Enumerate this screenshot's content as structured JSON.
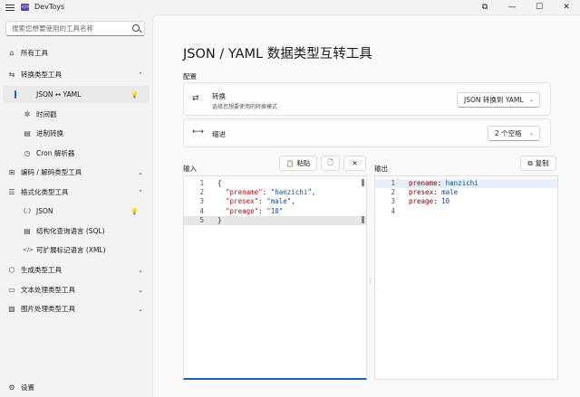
{
  "app": {
    "title": "DevToys",
    "logo_text": "</>"
  },
  "window_controls": {
    "snap": "⧉",
    "minimize": "—",
    "maximize": "☐",
    "close": "✕"
  },
  "sidebar": {
    "search_placeholder": "搜索您想要使用的工具名称",
    "items": [
      {
        "label": "所有工具",
        "icon": "⌂"
      },
      {
        "label": "转换类型工具",
        "icon": "⇆",
        "chevron": "⌃"
      },
      {
        "label": "JSON ↔ YAML",
        "icon": "",
        "selected": true,
        "bulb": "💡"
      },
      {
        "label": "时间戳",
        "icon": "✲"
      },
      {
        "label": "进制转换",
        "icon": "▤"
      },
      {
        "label": "Cron 解析器",
        "icon": "◷"
      },
      {
        "label": "编码 / 解码类型工具",
        "icon": "⊞",
        "chevron": "⌄"
      },
      {
        "label": "格式化类型工具",
        "icon": "☰",
        "chevron": "⌃"
      },
      {
        "label": "JSON",
        "icon": "{;}",
        "bulb": "💡"
      },
      {
        "label": "结构化查询语言 (SQL)",
        "icon": "▤"
      },
      {
        "label": "可扩展标记语言 (XML)",
        "icon": "</>"
      },
      {
        "label": "生成类型工具",
        "icon": "⬡",
        "chevron": "⌄"
      },
      {
        "label": "文本处理类型工具",
        "icon": "▭",
        "chevron": "⌄"
      },
      {
        "label": "图片处理类型工具",
        "icon": "▨",
        "chevron": "⌄"
      }
    ],
    "settings_label": "设置",
    "settings_icon": "⚙"
  },
  "main": {
    "title": "JSON / YAML 数据类型互转工具",
    "config_label": "配置",
    "conversion": {
      "icon": "⇄",
      "title": "转换",
      "subtitle": "选择您想要使用的转换模式",
      "value": "JSON 转换到 YAML",
      "chevron": "⌄"
    },
    "indent": {
      "icon": "⟷",
      "title": "缩进",
      "value": "2 个空格",
      "chevron": "⌄"
    },
    "input": {
      "label": "输入",
      "paste_label": "粘贴",
      "paste_icon": "📋",
      "open_icon": "🗋",
      "clear_icon": "✕",
      "lines": [
        {
          "n": "1",
          "parts": [
            {
              "t": "{",
              "c": "brace"
            }
          ]
        },
        {
          "n": "2",
          "parts": [
            {
              "t": "  ",
              "c": ""
            },
            {
              "t": "\"prename\"",
              "c": "key"
            },
            {
              "t": ": ",
              "c": ""
            },
            {
              "t": "\"hanzichi\"",
              "c": "str"
            },
            {
              "t": ",",
              "c": ""
            }
          ]
        },
        {
          "n": "3",
          "parts": [
            {
              "t": "  ",
              "c": ""
            },
            {
              "t": "\"presex\"",
              "c": "key"
            },
            {
              "t": ": ",
              "c": ""
            },
            {
              "t": "\"male\"",
              "c": "str"
            },
            {
              "t": ",",
              "c": ""
            }
          ]
        },
        {
          "n": "4",
          "parts": [
            {
              "t": "  ",
              "c": ""
            },
            {
              "t": "\"preage\"",
              "c": "key"
            },
            {
              "t": ": ",
              "c": ""
            },
            {
              "t": "\"10\"",
              "c": "str"
            }
          ]
        },
        {
          "n": "5",
          "parts": [
            {
              "t": "}",
              "c": "brace"
            }
          ]
        }
      ]
    },
    "output": {
      "label": "输出",
      "copy_label": "复制",
      "copy_icon": "⧉",
      "lines": [
        {
          "n": "1",
          "parts": [
            {
              "t": "prename",
              "c": "ykey"
            },
            {
              "t": ": ",
              "c": ""
            },
            {
              "t": "hanzichi",
              "c": "yval"
            }
          ]
        },
        {
          "n": "2",
          "parts": [
            {
              "t": "presex",
              "c": "ykey"
            },
            {
              "t": ": ",
              "c": ""
            },
            {
              "t": "male",
              "c": "yval"
            }
          ]
        },
        {
          "n": "3",
          "parts": [
            {
              "t": "preage",
              "c": "ykey"
            },
            {
              "t": ": ",
              "c": ""
            },
            {
              "t": "10",
              "c": "yval"
            }
          ]
        },
        {
          "n": "4",
          "parts": []
        }
      ]
    }
  }
}
